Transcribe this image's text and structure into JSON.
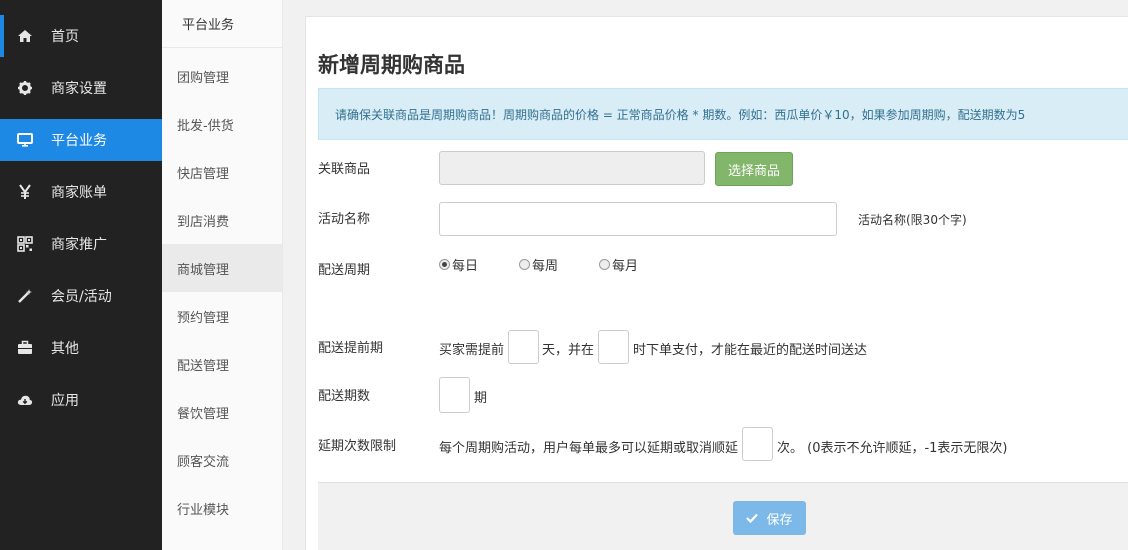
{
  "primary_nav": [
    {
      "label": "首页",
      "icon": "home-icon"
    },
    {
      "label": "商家设置",
      "icon": "gear-icon"
    },
    {
      "label": "平台业务",
      "icon": "monitor-icon"
    },
    {
      "label": "商家账单",
      "icon": "yen-icon"
    },
    {
      "label": "商家推广",
      "icon": "qrcode-icon"
    },
    {
      "label": "会员/活动",
      "icon": "magic-wand-icon"
    },
    {
      "label": "其他",
      "icon": "briefcase-icon"
    },
    {
      "label": "应用",
      "icon": "cloud-download-icon"
    }
  ],
  "secondary_nav": {
    "header": "平台业务",
    "items": [
      "团购管理",
      "批发-供货",
      "快店管理",
      "到店消费",
      "商城管理",
      "预约管理",
      "配送管理",
      "餐饮管理",
      "顾客交流",
      "行业模块"
    ]
  },
  "page": {
    "title": "新增周期购商品",
    "notice": "请确保关联商品是周期购商品！周期购商品的价格 = 正常商品价格 * 期数。例如：西瓜单价￥10，如果参加周期购，配送期数为5"
  },
  "form": {
    "linked_product_label": "关联商品",
    "select_product_button": "选择商品",
    "activity_name_label": "活动名称",
    "activity_name_hint": "活动名称(限30个字)",
    "delivery_cycle_label": "配送周期",
    "cycle_options": [
      "每日",
      "每周",
      "每月"
    ],
    "cycle_selected": "每日",
    "lead_time_label": "配送提前期",
    "lead_time_prefix": "买家需提前",
    "lead_time_mid": "天，并在",
    "lead_time_suffix": "时下单支付，才能在最近的配送时间送达",
    "periods_label": "配送期数",
    "periods_suffix": "期",
    "delay_label": "延期次数限制",
    "delay_prefix": "每个周期购活动，用户每单最多可以延期或取消顺延",
    "delay_suffix": "次。 (0表示不允许顺延，-1表示无限次)"
  },
  "footer": {
    "save_label": "保存"
  },
  "colors": {
    "sidebar_bg": "#222222",
    "accent": "#1e88e5",
    "notice_bg": "#d9edf7",
    "green_button": "#82b66a",
    "save_button": "#7cb8e8"
  }
}
